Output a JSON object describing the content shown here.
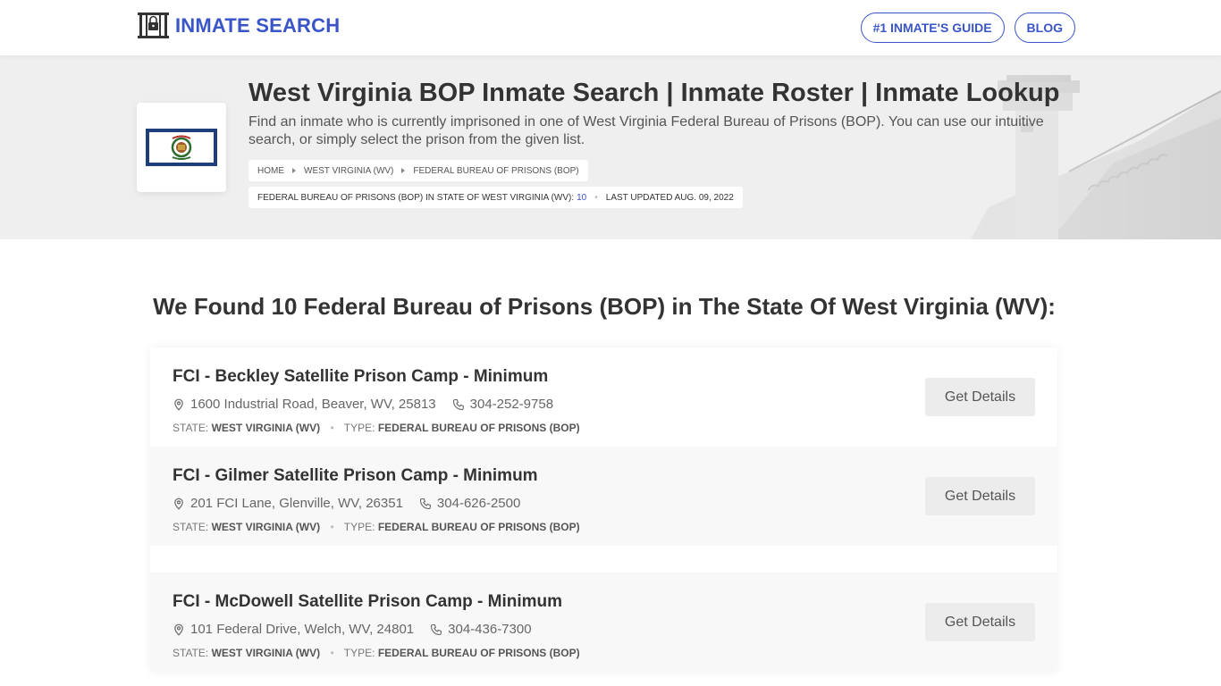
{
  "header": {
    "logo_text": "INMATE SEARCH",
    "nav": [
      {
        "label": "#1 INMATE'S GUIDE"
      },
      {
        "label": "BLOG"
      }
    ]
  },
  "hero": {
    "title": "West Virginia BOP Inmate Search | Inmate Roster | Inmate Lookup",
    "description": "Find an inmate who is currently imprisoned in one of West Virginia Federal Bureau of Prisons (BOP). You can use our intuitive search, or simply select the prison from the given list.",
    "breadcrumbs": [
      "HOME",
      "WEST VIRGINIA (WV)",
      "FEDERAL BUREAU OF PRISONS (BOP)"
    ],
    "meta_label": "FEDERAL BUREAU OF PRISONS (BOP) IN STATE OF WEST VIRGINIA (WV):",
    "meta_count": "10",
    "last_updated": "LAST UPDATED AUG. 09, 2022"
  },
  "main": {
    "heading": "We Found 10 Federal Bureau of Prisons (BOP) in The State Of West Virginia (WV):",
    "button_label": "Get Details",
    "state_label": "STATE:",
    "type_label": "TYPE:",
    "items": [
      {
        "name": "FCI - Beckley Satellite Prison Camp - Minimum",
        "address": "1600 Industrial Road, Beaver, WV, 25813",
        "phone": "304-252-9758",
        "state": "WEST VIRGINIA (WV)",
        "type": "FEDERAL BUREAU OF PRISONS (BOP)"
      },
      {
        "name": "FCI - Gilmer Satellite Prison Camp - Minimum",
        "address": "201 FCI Lane, Glenville, WV, 26351",
        "phone": "304-626-2500",
        "state": "WEST VIRGINIA (WV)",
        "type": "FEDERAL BUREAU OF PRISONS (BOP)"
      },
      {
        "name": "FCI - McDowell Satellite Prison Camp - Minimum",
        "address": "101 Federal Drive, Welch, WV, 24801",
        "phone": "304-436-7300",
        "state": "WEST VIRGINIA (WV)",
        "type": "FEDERAL BUREAU OF PRISONS (BOP)"
      }
    ]
  },
  "colors": {
    "brand": "#3a55c8",
    "hero_bg": "#efefef",
    "button_bg": "#ececec"
  },
  "icons": {
    "logo": "prison-gate-icon",
    "address": "map-pin-icon",
    "phone": "phone-icon",
    "breadcrumb_sep": "caret-right-icon"
  }
}
